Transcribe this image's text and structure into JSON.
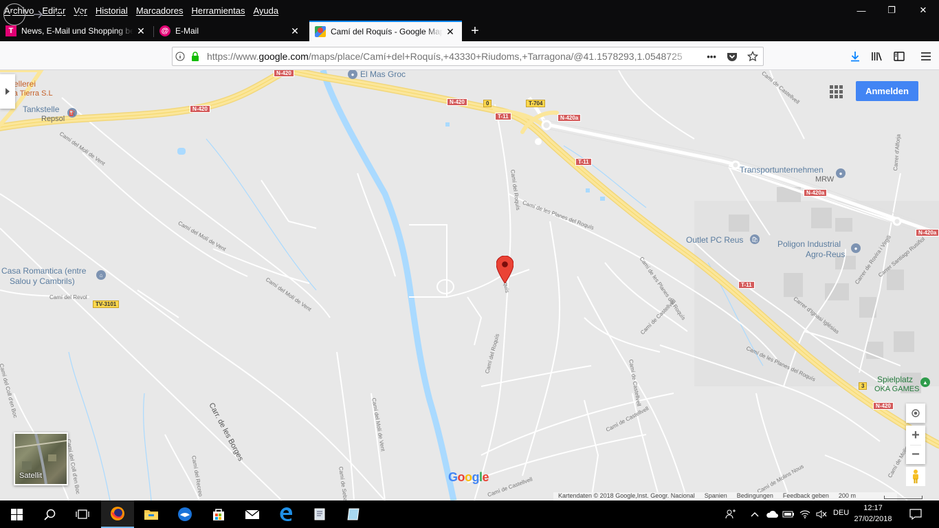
{
  "menubar": {
    "items": [
      "Archivo",
      "Editar",
      "Ver",
      "Historial",
      "Marcadores",
      "Herramientas",
      "Ayuda"
    ],
    "minimize": "—",
    "maximize": "❐",
    "close": "✕"
  },
  "tabs": [
    {
      "title": "News, E-Mail und Shopping bei Telekom",
      "icon": "telekom-t-icon",
      "close": "✕"
    },
    {
      "title": "E-Mail",
      "icon": "at-sign-icon",
      "close": "✕"
    },
    {
      "title": "Camí del Roquís - Google Maps",
      "icon": "google-maps-icon",
      "close": "✕"
    }
  ],
  "new_tab": "+",
  "navbar": {
    "url_prefix": "https://www.",
    "url_host": "google.com",
    "url_path": "/maps/place/Camí+del+Roquís,+43330+Riudoms,+Tarragona/@41.1578293,1.0548725",
    "page_actions": "•••"
  },
  "map": {
    "signin_label": "Anmelden",
    "satellite_label": "Satellit",
    "google_logo": [
      "G",
      "o",
      "o",
      "g",
      "l",
      "e"
    ],
    "google_logo_colors": [
      "#4285f4",
      "#ea4335",
      "#fbbc05",
      "#4285f4",
      "#34a853",
      "#ea4335"
    ],
    "zoom_in": "+",
    "zoom_out": "−",
    "pois": {
      "cellerei": "ellerei",
      "cellerei_sub": "de la Tierra S.L",
      "tankstelle": "Tankstelle",
      "tankstelle_sub": "Repsol",
      "mas_groc": "El Mas Groc",
      "transport": "Transportunternehmen",
      "transport_sub": "MRW",
      "outlet": "Outlet PC Reus",
      "poligon": "Poligon Industrial",
      "poligon_sub": "Agro-Reus",
      "casa_romantica": "Casa Romantica (entre",
      "casa_romantica_sub": "Salou y Cambrils)",
      "spielplatz": "Spielplatz",
      "spielplatz_sub": "OKA GAMES"
    },
    "shields": {
      "n420_a": "N-420",
      "n420_b": "N-420",
      "n420_c": "N-420",
      "n420_d": "N-420",
      "t11_a": "T-11",
      "t11_b": "T-11",
      "t11_c": "T-11",
      "t704": "T-704",
      "n420a_a": "N-420a",
      "n420a_b": "N-420a",
      "n420a_c": "N-420a",
      "tv3101": "TV-3101",
      "exit0": "0",
      "exit3": "3"
    },
    "street_labels": {
      "moli_vent_1": "Camí del Molí de Vent",
      "moli_vent_2": "Camí del Molí de Vent",
      "moli_vent_3": "Camí del Molí de Vent",
      "moli_vent_4": "Camí del Molí de Vent",
      "roquis_1": "Camí del Roquís",
      "roquis_2": "Camí del Roquís",
      "roquis_3": "Roquís",
      "planes_1": "Camí de les Planes del Roquís",
      "planes_2": "Camí de les Planes del Roquís",
      "planes_3": "Camí de les Planes del Roquís",
      "castellvell_1": "Camí de Castellvell",
      "castellvell_2": "Camí de Castellvell",
      "castellvell_3": "Camí de Castellvell",
      "castellvell_4": "Camí de Castellvell",
      "castellvell_5": "Camí de Castellvell",
      "revol": "Camí del Revol",
      "coll_boc": "Camí del Coll d'en Boc",
      "coll_boc_2": "Camí del Coll d'en Boc",
      "borges": "Carr. de les Borges",
      "alforja": "Carrer d'Alforja",
      "rovira": "Carrer de Rovira i Virgili",
      "santiago": "Carrer Santiago Rusiñol",
      "iglesias": "Carrer d'Ignasi Iglésias",
      "sebastia": "Camí de Sebastià",
      "recreo": "Camí del Recreo",
      "molins": "Camí de Molins Nous",
      "molins_2": "Camí de Molins Nous"
    },
    "attribution": [
      "Kartendaten © 2018 Google,Inst. Geogr. Nacional",
      "Spanien",
      "Bedingungen",
      "Feedback geben",
      "200 m"
    ]
  },
  "taskbar": {
    "lang": "DEU",
    "time": "12:17",
    "date": "27/02/2018"
  }
}
